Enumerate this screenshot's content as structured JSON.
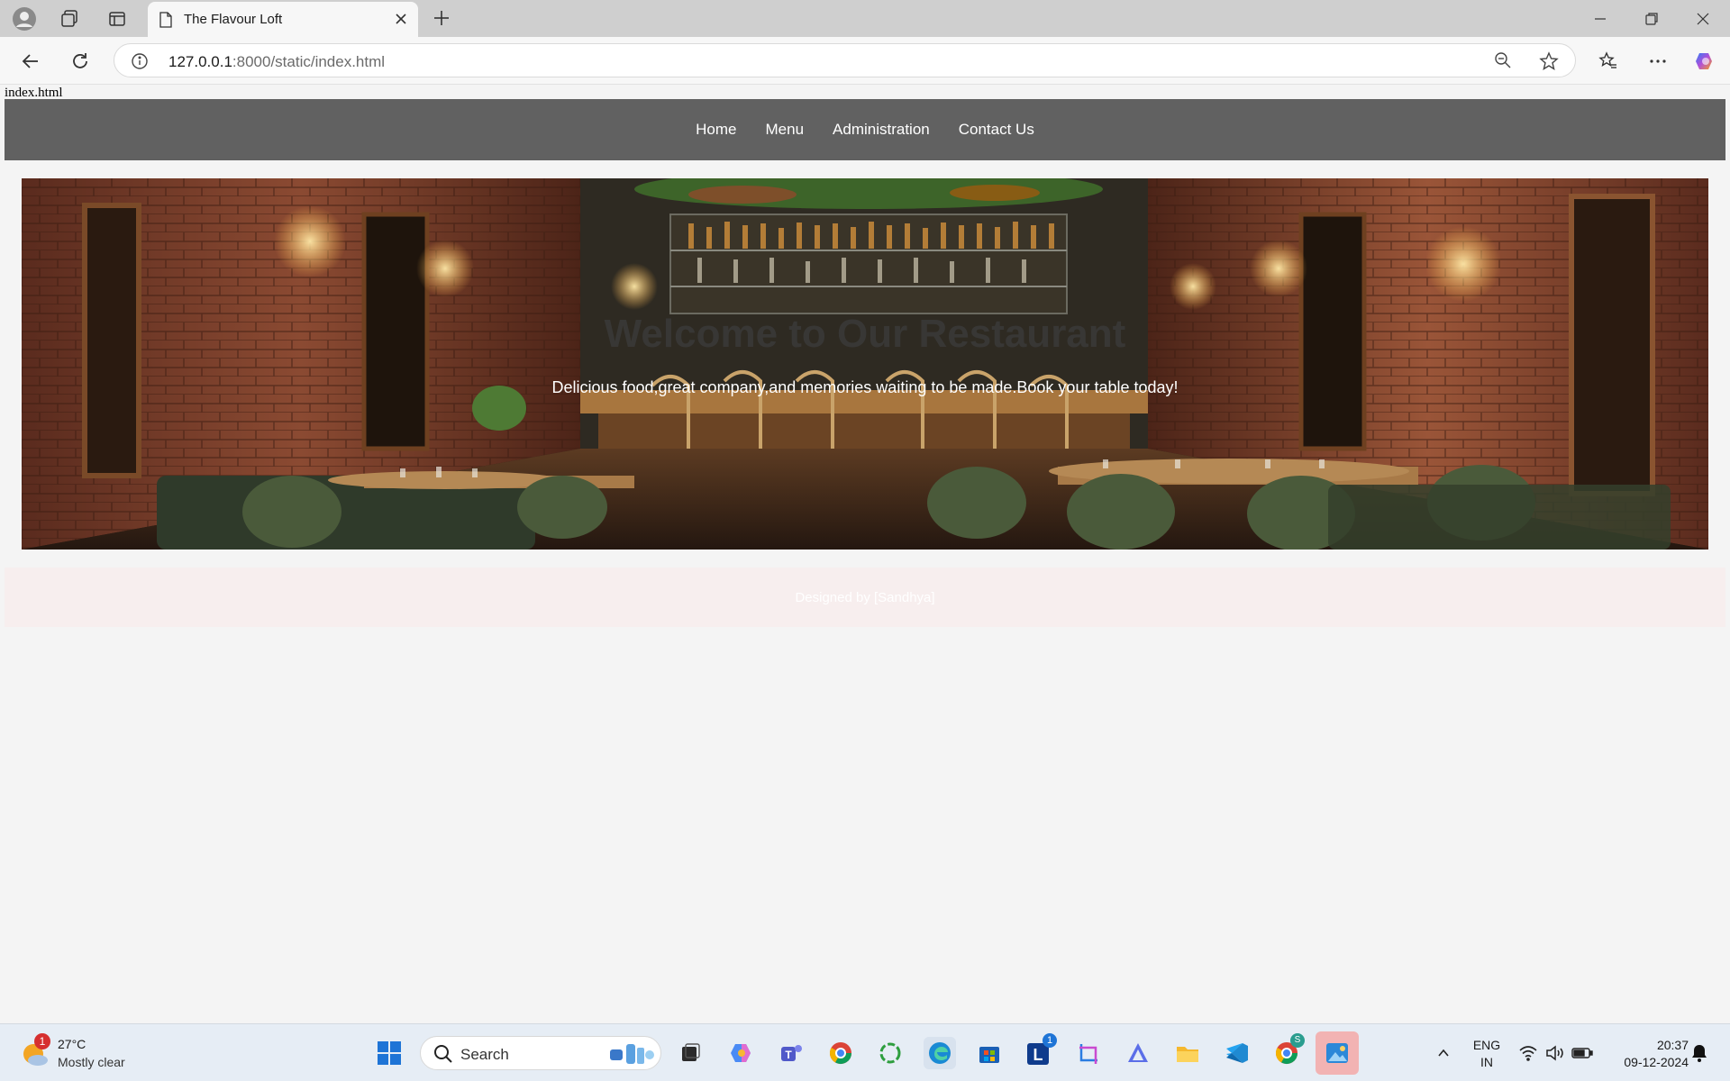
{
  "browser": {
    "tab_title": "The Flavour Loft",
    "url_host": "127.0.0.1",
    "url_rest": ":8000/static/index.html"
  },
  "page": {
    "file_label": "index.html",
    "nav": [
      "Home",
      "Menu",
      "Administration",
      "Contact Us"
    ],
    "hero_title": "Welcome to Our Restaurant",
    "hero_subtitle": "Delicious food,great company,and memories waiting to be made.Book your table today!",
    "footer_text": "Designed by [Sandhya]"
  },
  "taskbar": {
    "weather_temp": "27°C",
    "weather_desc": "Mostly clear",
    "weather_badge": "1",
    "search_label": "Search",
    "lang_line1": "ENG",
    "lang_line2": "IN",
    "time": "20:37",
    "date": "09-12-2024",
    "l_badge": "1",
    "chrome_badge": "S"
  },
  "colors": {
    "navbar_bg": "#616161",
    "footer_bg": "#f7eeee",
    "page_bg": "#f4f4f4"
  }
}
